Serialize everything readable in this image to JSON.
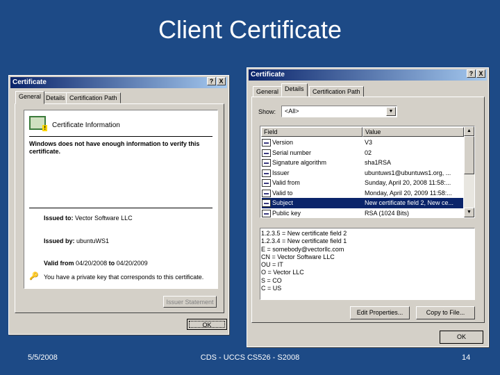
{
  "slide": {
    "title": "Client Certificate",
    "date": "5/5/2008",
    "footer": "CDS - UCCS CS526 - S2008",
    "page": "14"
  },
  "left_dialog": {
    "title": "Certificate",
    "help": "?",
    "close": "X",
    "tabs": [
      "General",
      "Details",
      "Certification Path"
    ],
    "info_heading": "Certificate Information",
    "warning": "Windows does not have enough information to verify this certificate.",
    "issued_to_label": "Issued to:",
    "issued_to": "Vector Software LLC",
    "issued_by_label": "Issued by:",
    "issued_by": "ubuntuWS1",
    "valid_label": "Valid from",
    "valid_from": "04/20/2008",
    "to_label": "to",
    "valid_to": "04/20/2009",
    "private_key": "You have a private key that corresponds to this certificate.",
    "issuer_statement": "Issuer Statement",
    "ok": "OK"
  },
  "right_dialog": {
    "title": "Certificate",
    "help": "?",
    "close": "X",
    "tabs": [
      "General",
      "Details",
      "Certification Path"
    ],
    "show_label": "Show:",
    "show_value": "<All>",
    "columns": [
      "Field",
      "Value"
    ],
    "rows": [
      {
        "field": "Version",
        "value": "V3"
      },
      {
        "field": "Serial number",
        "value": "02"
      },
      {
        "field": "Signature algorithm",
        "value": "sha1RSA"
      },
      {
        "field": "Issuer",
        "value": "ubuntuws1@ubuntuws1.org, ..."
      },
      {
        "field": "Valid from",
        "value": "Sunday, April 20, 2008 11:58:..."
      },
      {
        "field": "Valid to",
        "value": "Monday, April 20, 2009 11:58:..."
      },
      {
        "field": "Subject",
        "value": "New certificate field 2, New ce...",
        "selected": true
      },
      {
        "field": "Public key",
        "value": "RSA (1024 Bits)"
      }
    ],
    "detail_lines": [
      "1.2.3.5 = New certificate field 2",
      "1.2.3.4 = New certificate field 1",
      "E = somebody@vectorllc.com",
      "CN = Vector Software LLC",
      "OU = IT",
      "O = Vector LLC",
      "S = CO",
      "C = US"
    ],
    "edit_properties": "Edit Properties...",
    "copy_to_file": "Copy to File...",
    "ok": "OK"
  }
}
